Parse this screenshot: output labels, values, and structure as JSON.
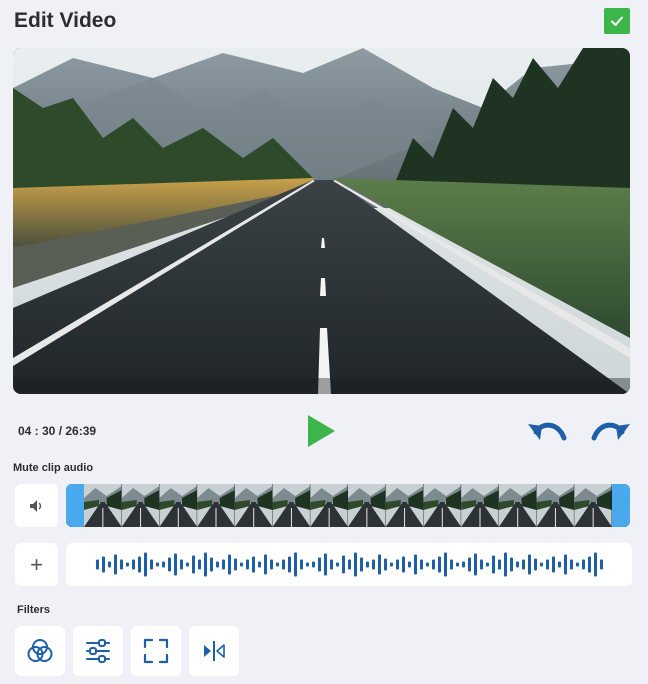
{
  "header": {
    "title": "Edit Video",
    "confirm_icon": "check-icon"
  },
  "player": {
    "time": "04 : 30 / 26:39",
    "play_icon": "play-icon",
    "undo_icon": "undo-icon",
    "redo_icon": "redo-icon"
  },
  "clip": {
    "mute_label": "Mute clip audio",
    "mute_icon": "speaker-icon",
    "frame_count": 14
  },
  "audio": {
    "add_label": "+"
  },
  "filters": {
    "label": "Filters",
    "tools": [
      {
        "name": "color-filter",
        "icon": "color-circles-icon"
      },
      {
        "name": "adjust",
        "icon": "sliders-icon"
      },
      {
        "name": "crop",
        "icon": "crop-frame-icon"
      },
      {
        "name": "flip",
        "icon": "flip-horizontal-icon"
      }
    ]
  },
  "colors": {
    "accent_green": "#3cb54a",
    "accent_blue": "#1e5fa8",
    "handle_blue": "#4aa9ec",
    "background": "#eff1f6"
  }
}
